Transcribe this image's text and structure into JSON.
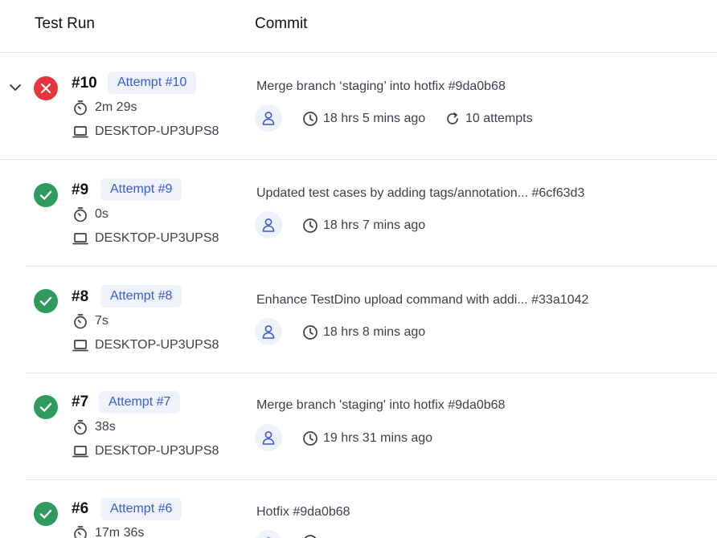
{
  "header": {
    "test_run": "Test Run",
    "commit": "Commit"
  },
  "colors": {
    "fail": "#e5353d",
    "pass": "#2e9a5d",
    "accent": "#3b5bd1",
    "badge_bg": "#eef2fb"
  },
  "runs": [
    {
      "number": "#10",
      "attempt": "Attempt #10",
      "status": "failed",
      "status_icon": "x-circle-icon",
      "duration": "2m 29s",
      "machine": "DESKTOP-UP3UPS8",
      "commit_message": "Merge branch ‘staging’ into hotfix #9da0b68",
      "time_ago": "18 hrs 5 mins ago",
      "attempts": "10 attempts"
    },
    {
      "number": "#9",
      "attempt": "Attempt #9",
      "status": "passed",
      "status_icon": "check-circle-icon",
      "duration": "0s",
      "machine": "DESKTOP-UP3UPS8",
      "commit_message": "Updated test cases by adding tags/annotation... #6cf63d3",
      "time_ago": "18 hrs 7 mins ago"
    },
    {
      "number": "#8",
      "attempt": "Attempt #8",
      "status": "passed",
      "status_icon": "check-circle-icon",
      "duration": "7s",
      "machine": "DESKTOP-UP3UPS8",
      "commit_message": "Enhance TestDino upload command with addi... #33a1042",
      "time_ago": "18 hrs 8 mins ago"
    },
    {
      "number": "#7",
      "attempt": "Attempt #7",
      "status": "passed",
      "status_icon": "check-circle-icon",
      "duration": "38s",
      "machine": "DESKTOP-UP3UPS8",
      "commit_message": "Merge branch 'staging' into hotfix #9da0b68",
      "time_ago": "19 hrs 31 mins ago"
    },
    {
      "number": "#6",
      "attempt": "Attempt #6",
      "status": "passed",
      "status_icon": "check-circle-icon",
      "duration": "17m 36s",
      "commit_message": "Hotfix #9da0b68"
    }
  ]
}
